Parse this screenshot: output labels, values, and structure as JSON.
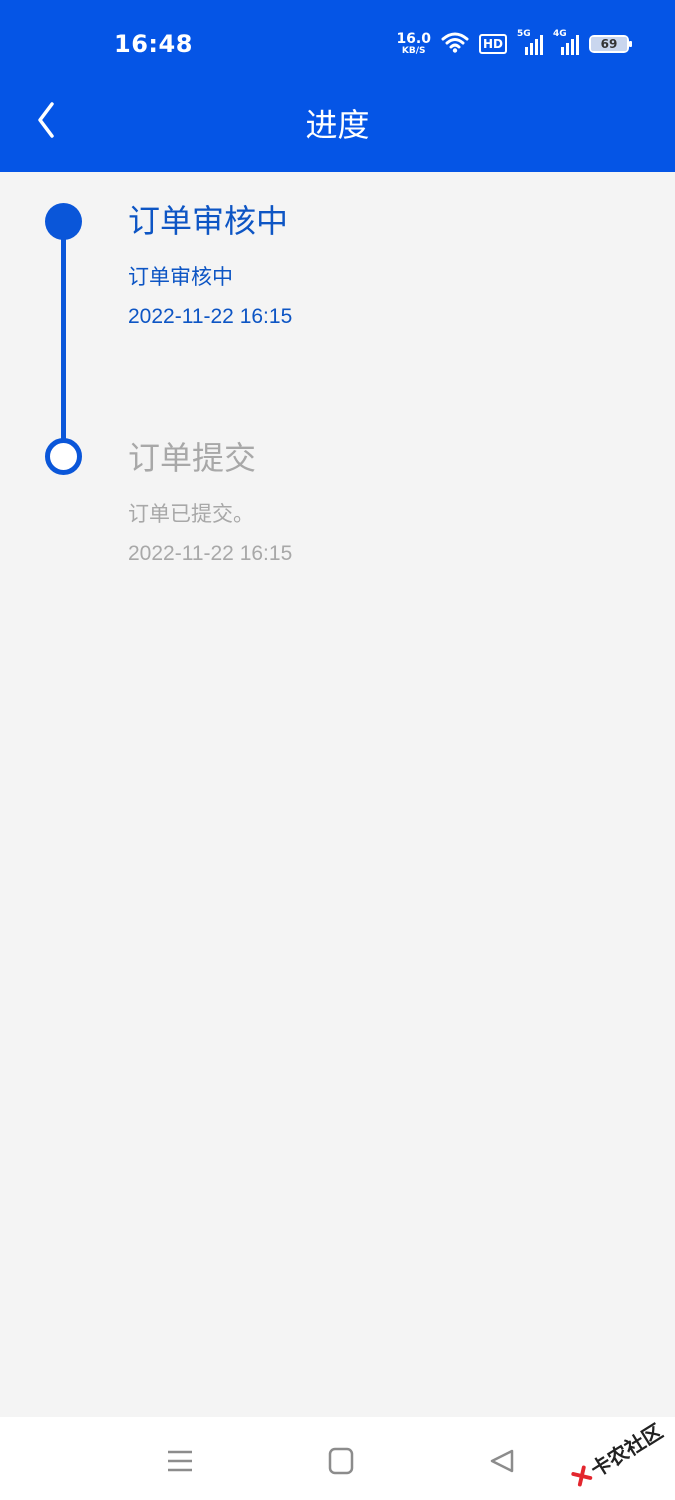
{
  "status_bar": {
    "time": "16:48",
    "net_speed_value": "16.0",
    "net_speed_unit": "KB/S",
    "hd_label": "HD",
    "signal1_label": "5G",
    "signal2_label": "4G",
    "battery_level": "69",
    "icons": [
      "wifi-icon",
      "hd-icon",
      "signal-5g-icon",
      "signal-4g-icon",
      "battery-icon"
    ]
  },
  "header": {
    "title": "进度",
    "back_icon": "chevron-left-icon",
    "background_color": "#0555e6"
  },
  "timeline": {
    "accent_color": "#0a56d9",
    "items": [
      {
        "title": "订单审核中",
        "description": "订单审核中",
        "time": "2022-11-22 16:15",
        "state": "active"
      },
      {
        "title": "订单提交",
        "description": "订单已提交。",
        "time": "2022-11-22 16:15",
        "state": "done"
      }
    ]
  },
  "nav_bar": {
    "icons": [
      "menu-icon",
      "home-icon",
      "back-triangle-icon"
    ]
  },
  "watermark": {
    "text": "卡农社区"
  }
}
